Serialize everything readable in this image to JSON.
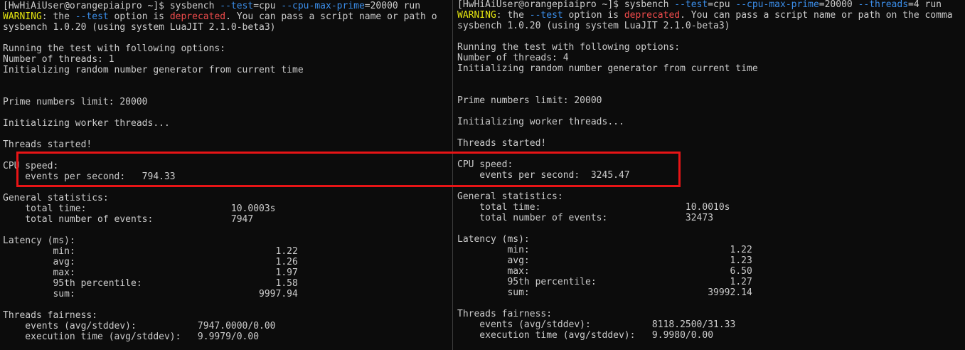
{
  "left": {
    "prompt": "[HwHiAiUser@orangepiaipro ~]$ ",
    "cmd_sysbench": "sysbench ",
    "cmd_test_opt": "--test",
    "cmd_test_val": "=cpu ",
    "cmd_prime_opt": "--cpu-max-prime",
    "cmd_prime_val": "=20000 run",
    "warn_label": "WARNING",
    "warn_a": ": the ",
    "warn_test": "--test",
    "warn_b": " option is ",
    "warn_dep": "deprecated",
    "warn_c": ". You can pass a script name or path o",
    "version": "sysbench 1.0.20 (using system LuaJIT 2.1.0-beta3)",
    "running": "Running the test with following options:",
    "threads": "Number of threads: 1",
    "init_rng": "Initializing random number generator from current time",
    "prime_limit": "Prime numbers limit: 20000",
    "init_workers": "Initializing worker threads...",
    "started": "Threads started!",
    "cpu_speed": "CPU speed:",
    "eps": "    events per second:   794.33",
    "general": "General statistics:",
    "total_time": "    total time:                          10.0003s",
    "total_events": "    total number of events:              7947",
    "latency": "Latency (ms):",
    "min": "         min:                                    1.22",
    "avg": "         avg:                                    1.26",
    "max": "         max:                                    1.97",
    "p95": "         95th percentile:                        1.58",
    "sum": "         sum:                                 9997.94",
    "fairness": "Threads fairness:",
    "events_std": "    events (avg/stddev):           7947.0000/0.00",
    "exec_std": "    execution time (avg/stddev):   9.9979/0.00"
  },
  "right": {
    "prompt": "[HwHiAiUser@orangepiaipro ~]$ ",
    "cmd_sysbench": "sysbench ",
    "cmd_test_opt": "--test",
    "cmd_test_val": "=cpu ",
    "cmd_prime_opt": "--cpu-max-prime",
    "cmd_prime_val": "=20000 ",
    "cmd_threads_opt": "--threads",
    "cmd_threads_val": "=4 run",
    "warn_label": "WARNING",
    "warn_a": ": the ",
    "warn_test": "--test",
    "warn_b": " option is ",
    "warn_dep": "deprecated",
    "warn_c": ". You can pass a script name or path on the comma",
    "version": "sysbench 1.0.20 (using system LuaJIT 2.1.0-beta3)",
    "running": "Running the test with following options:",
    "threads": "Number of threads: 4",
    "init_rng": "Initializing random number generator from current time",
    "prime_limit": "Prime numbers limit: 20000",
    "init_workers": "Initializing worker threads...",
    "started": "Threads started!",
    "cpu_speed": "CPU speed:",
    "eps": "    events per second:  3245.47",
    "general": "General statistics:",
    "total_time": "    total time:                          10.0010s",
    "total_events": "    total number of events:              32473",
    "latency": "Latency (ms):",
    "min": "         min:                                    1.22",
    "avg": "         avg:                                    1.23",
    "max": "         max:                                    6.50",
    "p95": "         95th percentile:                        1.27",
    "sum": "         sum:                                39992.14",
    "fairness": "Threads fairness:",
    "events_std": "    events (avg/stddev):           8118.2500/31.33",
    "exec_std": "    execution time (avg/stddev):   9.9980/0.00"
  },
  "colors": {
    "background": "#0c0c0c",
    "text": "#cccccc",
    "option": "#3b8eea",
    "warning": "#e5e510",
    "deprecated": "#f14c4c",
    "highlight": "#e81416"
  }
}
